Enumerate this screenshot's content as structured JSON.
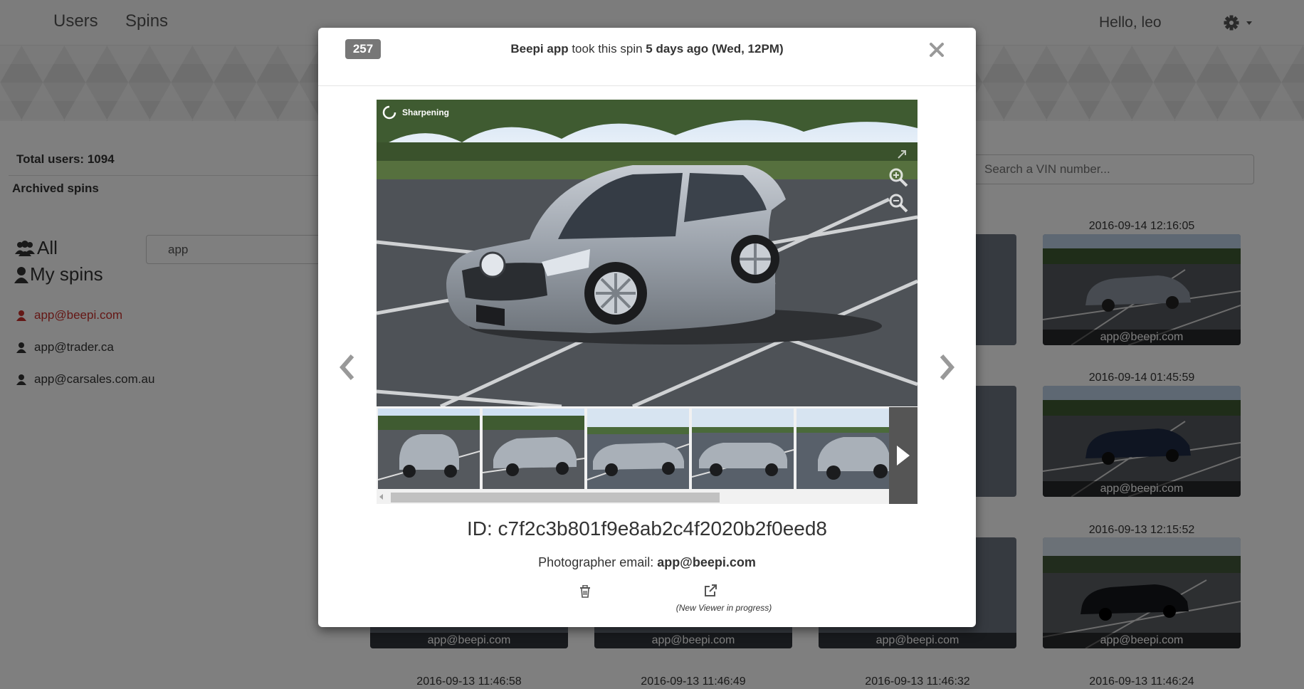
{
  "navbar": {
    "links": [
      "Users",
      "Spins"
    ],
    "greeting": "Hello, leo",
    "settings_icon": "gear-icon"
  },
  "sidebar": {
    "total_users": "Total users: 1094",
    "archived": "Archived spins",
    "filters": {
      "all": "All",
      "my": "My spins"
    },
    "user_search_value": "app",
    "users": [
      {
        "email": "app@beepi.com",
        "active": true
      },
      {
        "email": "app@trader.ca",
        "active": false
      },
      {
        "email": "app@carsales.com.au",
        "active": false
      }
    ]
  },
  "vin_search": {
    "placeholder": "Search a VIN number..."
  },
  "grid": {
    "cards": [
      {
        "date": "2016-09-14 12:16:05",
        "user": "app@beepi.com",
        "color": "#8e96a2"
      },
      {
        "date": "2016-09-14 01:45:59",
        "user": "app@beepi.com",
        "color": "#1f2a44"
      },
      {
        "date": "2016-09-13 12:15:52",
        "user": "app@beepi.com",
        "color": "#15161a"
      }
    ],
    "bottom_users": [
      "app@beepi.com",
      "app@beepi.com",
      "app@beepi.com",
      "app@beepi.com"
    ],
    "bottom_dates": [
      "2016-09-13 11:46:58",
      "2016-09-13 11:46:49",
      "2016-09-13 11:46:32",
      "2016-09-13 11:46:24"
    ]
  },
  "modal": {
    "badge": "257",
    "title": {
      "author": "Beepi app",
      "middle": " took this spin ",
      "when": "5 days ago (Wed, 12PM)"
    },
    "viewer_status": "Sharpening",
    "spin_id": "ID: c7f2c3b801f9e8ab2c4f2020b2f0eed8",
    "photographer_label": "Photographer email: ",
    "photographer_email": "app@beepi.com",
    "viewer_note": "(New Viewer in progress)",
    "thumbnail_count": 5
  },
  "colors": {
    "active_user": "#c9302c",
    "badge": "#777777",
    "car": "#a9b0b8"
  }
}
